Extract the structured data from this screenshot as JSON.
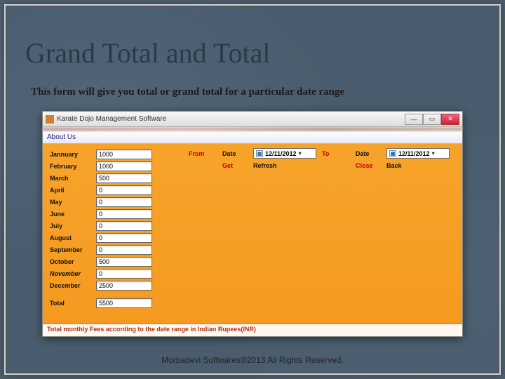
{
  "slide": {
    "title": "Grand Total and Total",
    "description": "This form will give you total or grand total for a particular date range"
  },
  "window": {
    "title": "Karate Dojo Management Software",
    "menu": {
      "about": "About Us"
    }
  },
  "months": [
    {
      "label": "Jannuary",
      "value": "1000",
      "italic": false
    },
    {
      "label": "February",
      "value": "1000",
      "italic": false
    },
    {
      "label": "March",
      "value": "500",
      "italic": false
    },
    {
      "label": "April",
      "value": "0",
      "italic": false
    },
    {
      "label": "May",
      "value": "0",
      "italic": false
    },
    {
      "label": "June",
      "value": "0",
      "italic": false
    },
    {
      "label": "July",
      "value": "0",
      "italic": false
    },
    {
      "label": "August",
      "value": "0",
      "italic": false
    },
    {
      "label": "September",
      "value": "0",
      "italic": false
    },
    {
      "label": "October",
      "value": "500",
      "italic": false
    },
    {
      "label": "November",
      "value": "0",
      "italic": true
    },
    {
      "label": "December",
      "value": "2500",
      "italic": false
    }
  ],
  "total": {
    "label": "Total",
    "value": "5500"
  },
  "controls": {
    "from": "From",
    "to": "To",
    "date_label": "Date",
    "from_date": "12/11/2012",
    "to_date": "12/11/2012",
    "get": "Get",
    "refresh": "Refresh",
    "close": "Close",
    "back": "Back"
  },
  "footer": "Total monthly Fees according to the date range in Indian Rupees(INR)",
  "copyright": "Morbadevi Softwares®2013 All Rights Reserved."
}
